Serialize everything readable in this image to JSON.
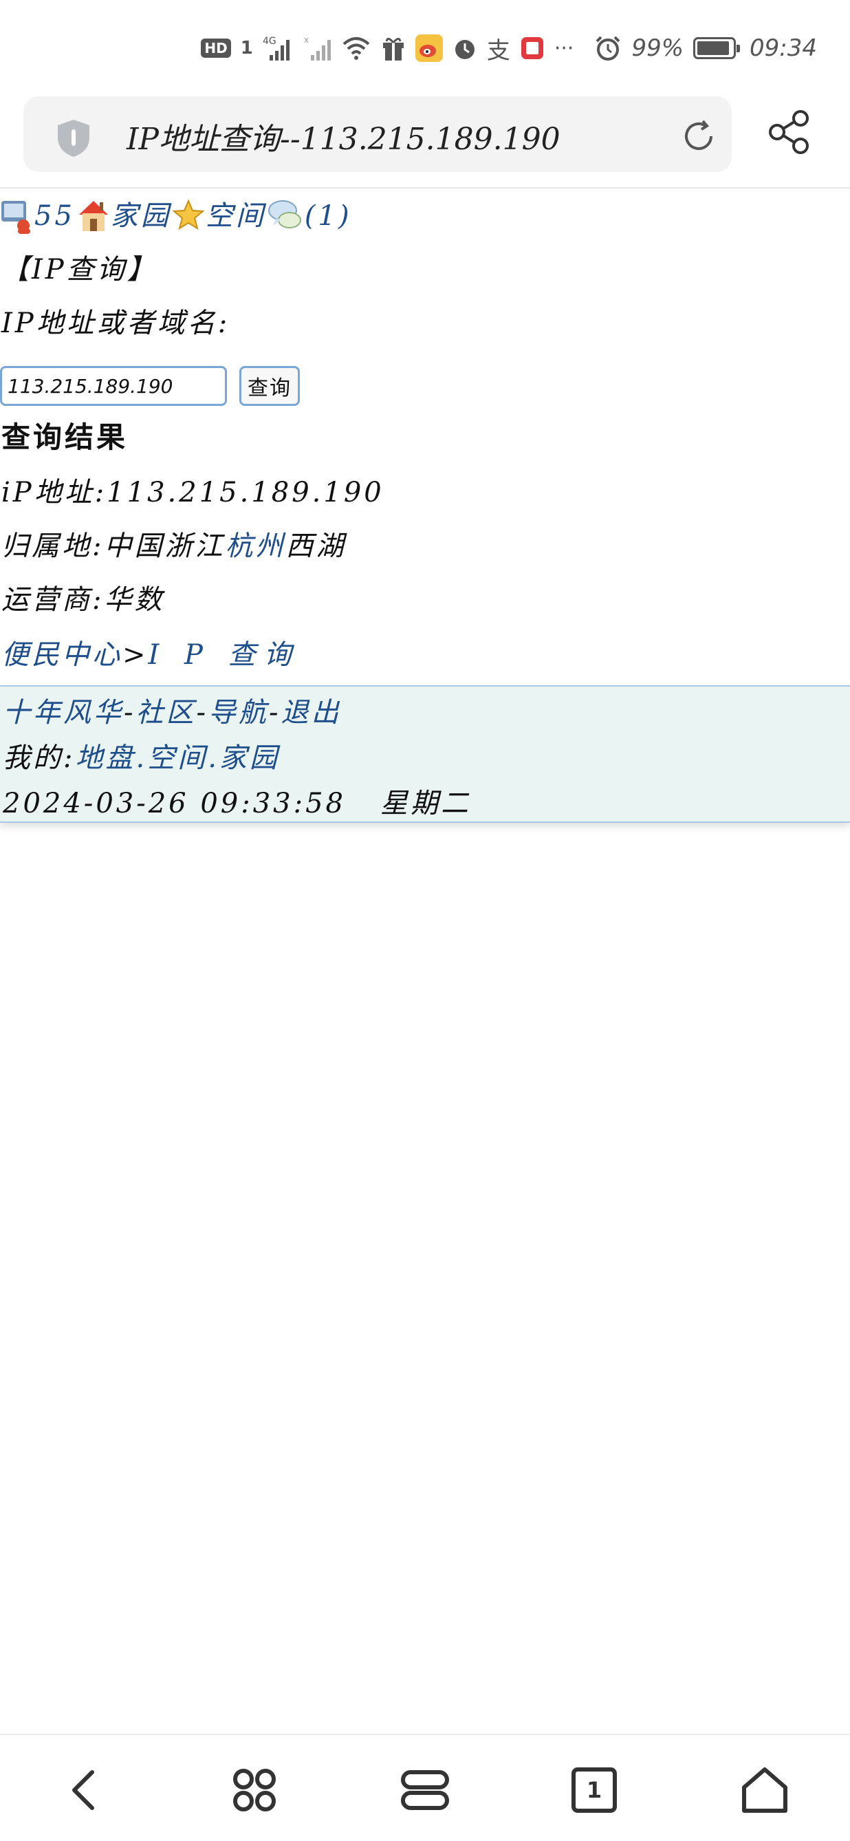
{
  "status_bar": {
    "hd_label": "HD",
    "sim_label": "1",
    "network_label": "4G",
    "battery_text": "99%",
    "time": "09:34",
    "more": "···"
  },
  "browser": {
    "page_title": "IP地址查询--113.215.189.190"
  },
  "page": {
    "nav": {
      "count_link": "55",
      "home_link": "家园",
      "space_link": "空间",
      "messages_link": "(1)"
    },
    "section_title": "【IP查询】",
    "input_label": "IP地址或者域名:",
    "ip_input_value": "113.215.189.190",
    "query_button": "查询",
    "result_heading": "查询结果",
    "result_ip_label": "iP地址:",
    "result_ip_value": "113.215.189.190",
    "location_label": "归属地:",
    "location_prefix": "中国浙江",
    "location_city_link": "杭州",
    "location_suffix": "西湖",
    "isp_label": "运营商:",
    "isp_value": "华数",
    "breadcrumb_link": "便民中心",
    "breadcrumb_sep": ">",
    "breadcrumb_current": "I P 查询"
  },
  "footer": {
    "link_site": "十年风华",
    "link_community": "社区",
    "link_nav": "导航",
    "link_logout": "退出",
    "sep": "-",
    "mine_label": "我的:",
    "link_disk": "地盘",
    "link_space": "空间",
    "link_home": "家园",
    "dot": ".",
    "datetime": "2024-03-26 09:33:58",
    "weekday": "星期二"
  },
  "bottom_nav": {
    "tabs_count": "1"
  },
  "colors": {
    "link": "#1f4e8c",
    "footer_bg": "#e9f4f3",
    "input_border": "#7aa6d6"
  }
}
